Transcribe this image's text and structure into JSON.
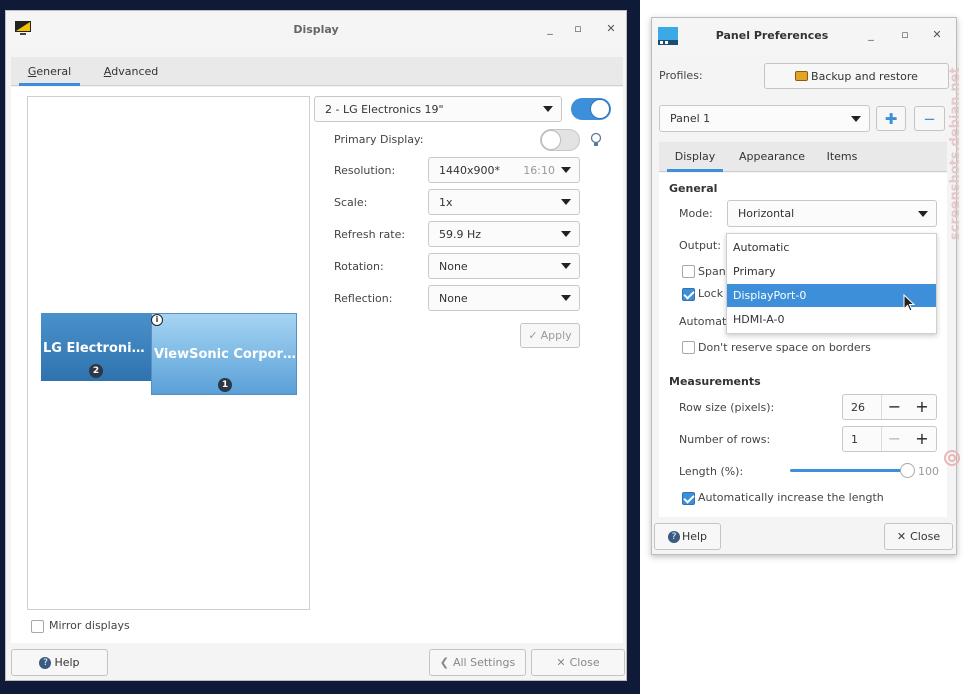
{
  "display_window": {
    "title": "Display",
    "tabs": [
      {
        "label": "General",
        "mnemonic": "G",
        "rest": "eneral"
      },
      {
        "label": "Advanced",
        "mnemonic": "A",
        "rest": "dvanced"
      }
    ],
    "monitors": [
      {
        "name": "LG Electroni…",
        "number": "2"
      },
      {
        "name": "ViewSonic Corpor…",
        "number": "1"
      }
    ],
    "mirror_label": "Mirror displays",
    "selected_display": "2 - LG Electronics 19\"",
    "primary_label": "Primary Display:",
    "rows": [
      {
        "label": "Resolution:",
        "value": "1440x900*",
        "extra": "16:10"
      },
      {
        "label": "Scale:",
        "value": "1x"
      },
      {
        "label": "Refresh rate:",
        "value": "59.9 Hz"
      },
      {
        "label": "Rotation:",
        "value": "None"
      },
      {
        "label": "Reflection:",
        "value": "None"
      }
    ],
    "apply_label": "Apply",
    "help_label": "Help",
    "all_settings_label": "All Settings",
    "close_label": "Close"
  },
  "panel_window": {
    "title": "Panel Preferences",
    "profiles_label": "Profiles:",
    "backup_label": "Backup and restore",
    "panel_select": "Panel 1",
    "tabs": [
      {
        "label": "Display"
      },
      {
        "label": "Appearance"
      },
      {
        "label": "Items"
      }
    ],
    "general_header": "General",
    "mode_label": "Mode:",
    "mode_value": "Horizontal",
    "output_label": "Output:",
    "output_options": [
      "Automatic",
      "Primary",
      "DisplayPort-0",
      "HDMI-A-0"
    ],
    "span_label": "Span",
    "lock_label": "Lock",
    "auto_label": "Automati",
    "reserve_label": "Don't reserve space on borders",
    "measurements_header": "Measurements",
    "row_size_label": "Row size (pixels):",
    "row_size_value": "26",
    "rows_label": "Number of rows:",
    "rows_value": "1",
    "length_label": "Length (%):",
    "length_value": "100",
    "auto_length_label": "Automatically increase the length",
    "help_label": "Help",
    "close_label": "Close"
  },
  "watermark": "screenshots.debian.net",
  "colors": {
    "accent": "#3d8fd9",
    "desktop": "#0e1a38",
    "monitor_lg": "#3f86c0",
    "monitor_vs": "#7ab8e4"
  }
}
